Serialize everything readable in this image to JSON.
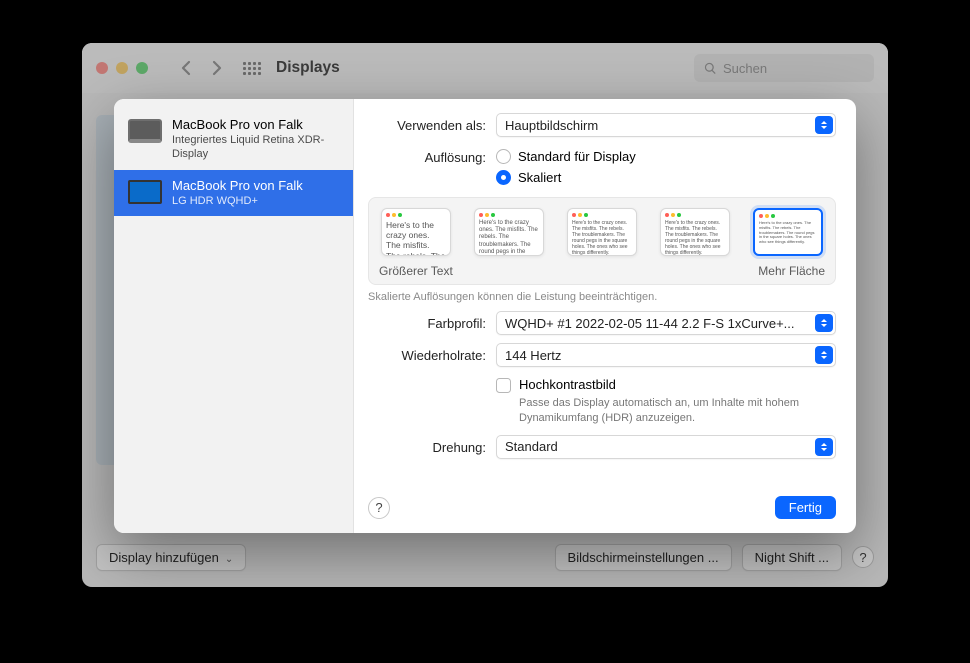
{
  "window": {
    "title": "Displays",
    "search_placeholder": "Suchen"
  },
  "bottom": {
    "add_display": "Display hinzufügen",
    "display_settings": "Bildschirmeinstellungen ...",
    "night_shift": "Night Shift ..."
  },
  "sidebar": {
    "items": [
      {
        "name": "MacBook Pro von Falk",
        "sub": "Integriertes Liquid Retina XDR-Display"
      },
      {
        "name": "MacBook Pro von Falk",
        "sub": "LG HDR WQHD+"
      }
    ]
  },
  "labels": {
    "use_as": "Verwenden als:",
    "resolution": "Auflösung:",
    "color_profile": "Farbprofil:",
    "refresh_rate": "Wiederholrate:",
    "rotation": "Drehung:"
  },
  "values": {
    "use_as": "Hauptbildschirm",
    "resolution_default": "Standard für Display",
    "resolution_scaled": "Skaliert",
    "scale_left": "Größerer Text",
    "scale_right": "Mehr Fläche",
    "scale_note": "Skalierte Auflösungen können die Leistung beeinträchtigen.",
    "color_profile": "WQHD+ #1 2022-02-05 11-44 2.2 F-S 1xCurve+...",
    "refresh_rate": "144 Hertz",
    "hdr_label": "Hochkontrastbild",
    "hdr_hint": "Passe das Display automatisch an, um Inhalte mit hohem Dynamikumfang (HDR) anzuzeigen.",
    "rotation": "Standard",
    "thumb_text": "Here's to the crazy ones. The misfits. The rebels. The troublemakers. The round pegs in the square holes. The ones who see things differently."
  },
  "buttons": {
    "done": "Fertig",
    "help": "?"
  }
}
